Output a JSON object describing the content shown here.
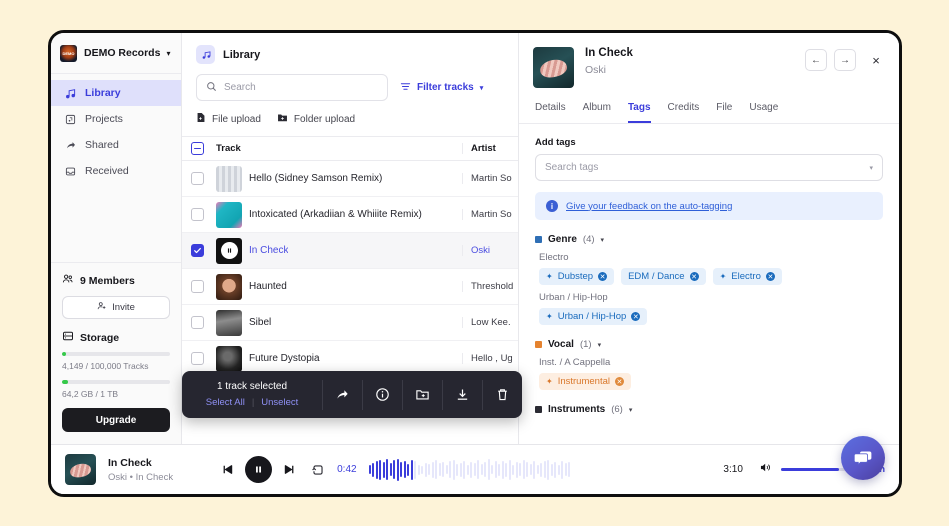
{
  "workspace": {
    "name": "DEMO Records",
    "caret": "chevron-down"
  },
  "sidebar": {
    "items": [
      {
        "label": "Library",
        "icon": "music-note-icon",
        "active": true
      },
      {
        "label": "Projects",
        "icon": "projects-icon",
        "active": false
      },
      {
        "label": "Shared",
        "icon": "share-icon",
        "active": false
      },
      {
        "label": "Received",
        "icon": "inbox-icon",
        "active": false
      }
    ],
    "members_label": "9 Members",
    "invite_label": "Invite",
    "storage_label": "Storage",
    "tracks_usage": "4,149 / 100,000 Tracks",
    "tracks_percent": 4,
    "storage_usage": "64,2 GB / 1 TB",
    "storage_percent": 6,
    "upgrade_label": "Upgrade"
  },
  "library": {
    "title": "Library",
    "search_placeholder": "Search",
    "search_value": "",
    "filter_label": "Filter tracks",
    "file_upload_label": "File upload",
    "folder_upload_label": "Folder upload",
    "columns": {
      "track": "Track",
      "artist": "Artist"
    },
    "rows": [
      {
        "title": "Hello (Sidney Samson Remix)",
        "artist": "Martin So",
        "checked": false,
        "selected": false,
        "art": "band"
      },
      {
        "title": "Intoxicated (Arkadiian & Whiiite Remix)",
        "artist": "Martin So",
        "checked": false,
        "selected": false,
        "art": "cyan"
      },
      {
        "title": "In Check",
        "artist": "Oski",
        "checked": true,
        "selected": true,
        "art": "pause"
      },
      {
        "title": "Haunted",
        "artist": "Threshold",
        "checked": false,
        "selected": false,
        "art": "brown"
      },
      {
        "title": "Sibel",
        "artist": "Low Kee.",
        "checked": false,
        "selected": false,
        "art": "gray"
      },
      {
        "title": "Future Dystopia",
        "artist": "Hello , Ug",
        "checked": false,
        "selected": false,
        "art": "dark"
      }
    ]
  },
  "selection_toolbar": {
    "count_label": "1 track selected",
    "select_all_label": "Select All",
    "unselect_label": "Unselect",
    "actions": [
      "share-icon",
      "info-icon",
      "add-to-folder-icon",
      "download-icon",
      "delete-icon"
    ]
  },
  "detail": {
    "track_title": "In Check",
    "track_artist": "Oski",
    "nav": {
      "prev": "←",
      "next": "→",
      "close": "×"
    },
    "tabs": [
      {
        "label": "Details",
        "active": false
      },
      {
        "label": "Album",
        "active": false
      },
      {
        "label": "Tags",
        "active": true
      },
      {
        "label": "Credits",
        "active": false
      },
      {
        "label": "File",
        "active": false
      },
      {
        "label": "Usage",
        "active": false
      }
    ],
    "add_tags_label": "Add tags",
    "tag_search_placeholder": "Search tags",
    "notice_text": "Give your feedback on the auto-tagging",
    "groups": [
      {
        "name": "Genre",
        "count": "(4)",
        "color": "#2f6fb5",
        "subgroups": [
          {
            "label": "Electro",
            "chips": [
              {
                "text": "Dubstep",
                "wand": true,
                "style": "blue"
              },
              {
                "text": "EDM / Dance",
                "wand": false,
                "style": "blue"
              },
              {
                "text": "Electro",
                "wand": true,
                "style": "blue"
              }
            ]
          },
          {
            "label": "Urban / Hip-Hop",
            "chips": [
              {
                "text": "Urban / Hip-Hop",
                "wand": true,
                "style": "blue"
              }
            ]
          }
        ]
      },
      {
        "name": "Vocal",
        "count": "(1)",
        "color": "#e5832f",
        "subgroups": [
          {
            "label": "Inst. / A Cappella",
            "chips": [
              {
                "text": "Instrumental",
                "wand": true,
                "style": "orange"
              }
            ]
          }
        ]
      },
      {
        "name": "Instruments",
        "count": "(6)",
        "color": "#2b2b33",
        "subgroups": []
      }
    ]
  },
  "player": {
    "title": "In Check",
    "subtitle": "Oski • In Check",
    "current_time": "0:42",
    "total_time": "3:10",
    "volume_label": "High",
    "volume_percent": 78,
    "progress_percent": 22,
    "controls": [
      "prev-icon",
      "pause-icon",
      "next-icon",
      "repeat-icon"
    ]
  },
  "chat_widget": {
    "icon": "chat-bubble-icon"
  }
}
